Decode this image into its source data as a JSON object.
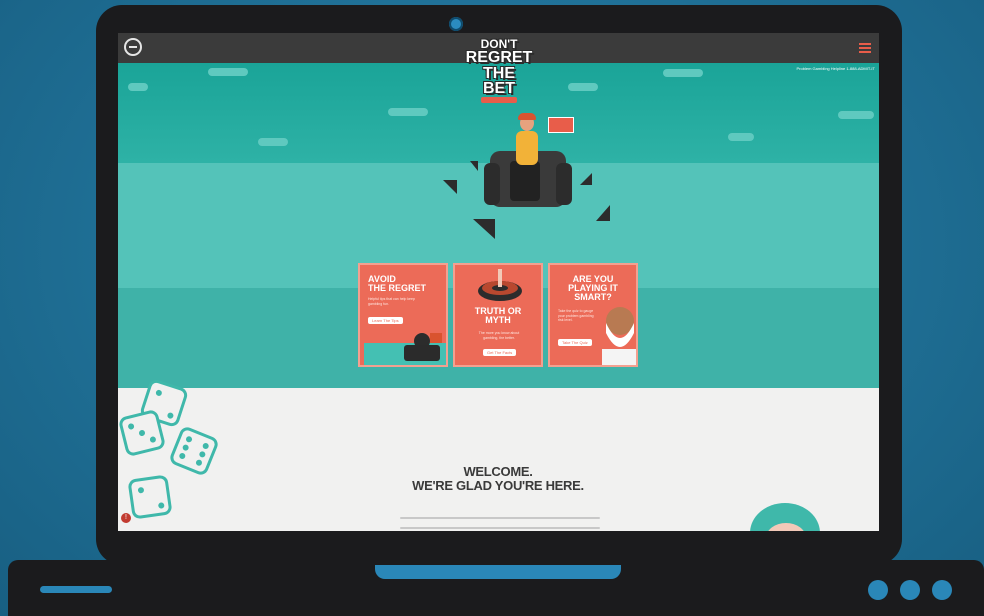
{
  "site": {
    "logo": {
      "line1": "DON'T",
      "line2": "REGRET",
      "line3": "THE BET"
    },
    "helpline": "Problem Gambling Helpline 1-888-ADMIT-IT",
    "menu_icon": "hamburger-menu-icon",
    "brand_icon": "circle-logo-icon"
  },
  "cards": [
    {
      "title_a": "AVOID",
      "title_b": "THE REGRET",
      "text": "Helpful tips that can help keep gambling fun.",
      "button": "Learn The Tips"
    },
    {
      "title_a": "TRUTH OR",
      "title_b": "MYTH",
      "text": "The more you know about gambling, the better.",
      "button": "Get The Facts"
    },
    {
      "title_a": "ARE YOU",
      "title_b": "PLAYING IT",
      "title_c": "SMART?",
      "text": "Take the quiz to gauge your problem gambling risk level.",
      "button": "Take The Quiz"
    }
  ],
  "welcome": {
    "line1": "WELCOME.",
    "line2": "WE'RE GLAD YOU'RE HERE."
  },
  "colors": {
    "accent": "#ec6b58",
    "teal": "#54c3b9",
    "dark": "#1b1b1d",
    "background": "#1f6f95"
  }
}
